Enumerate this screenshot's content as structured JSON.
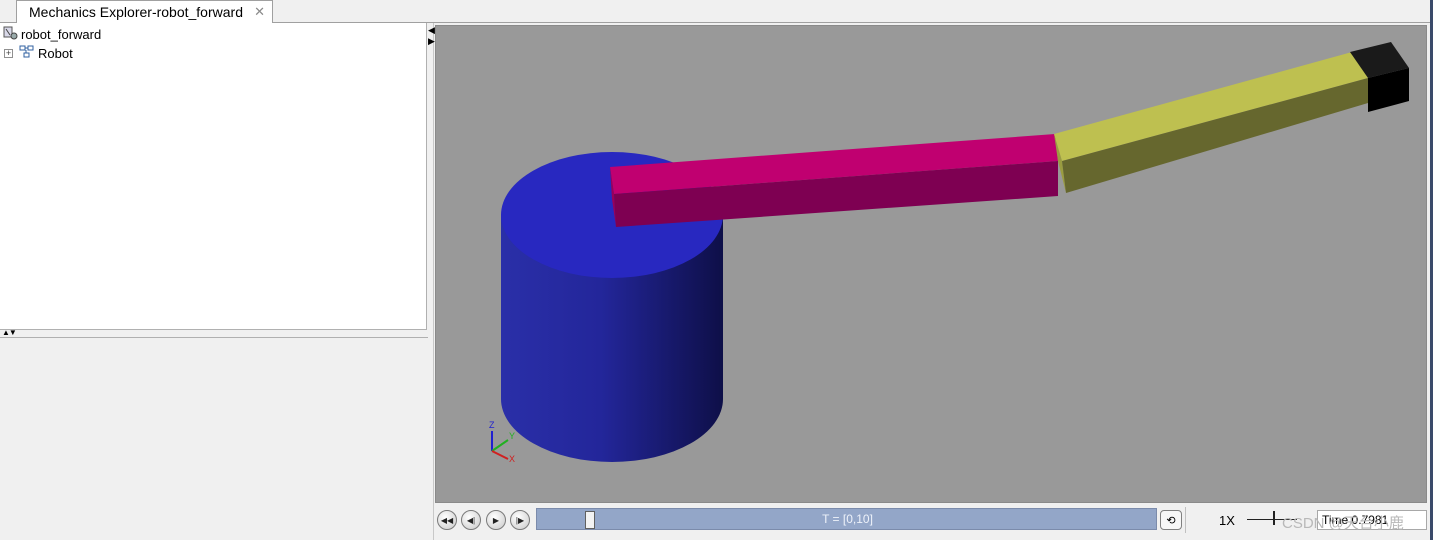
{
  "tab": {
    "title": "Mechanics Explorer-robot_forward",
    "close_glyph": "✕"
  },
  "tree": {
    "root_label": "robot_forward",
    "child_label": "Robot",
    "expander_glyph": "+"
  },
  "viewport": {
    "background_color": "#999999",
    "triad_labels": {
      "z": "Z",
      "y": "Y",
      "x": "X"
    }
  },
  "playback": {
    "timeline_label": "T = [0,10]",
    "progress_fraction": 0.078,
    "speed_label": "1X",
    "time_readout": "Time 0.7981"
  },
  "watermark": "CSDN @天台小鹿",
  "colors": {
    "base": "#2828c0",
    "link1": "#c00070",
    "link2": "#bec050",
    "tip": "#000000"
  }
}
